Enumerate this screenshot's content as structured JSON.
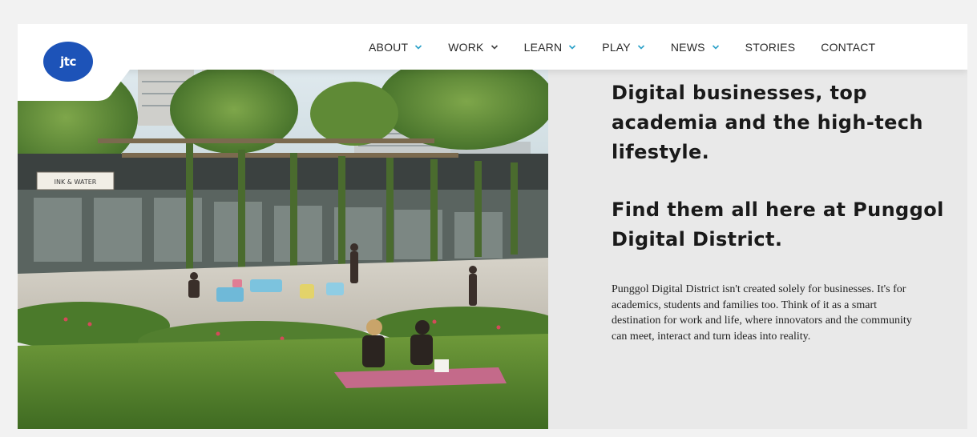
{
  "logo": {
    "text": "jtc"
  },
  "nav": {
    "items": [
      {
        "label": "ABOUT",
        "has_dropdown": true,
        "chevron_color": "#2aa0c8"
      },
      {
        "label": "WORK",
        "has_dropdown": true,
        "chevron_color": "#444444"
      },
      {
        "label": "LEARN",
        "has_dropdown": true,
        "chevron_color": "#2aa0c8"
      },
      {
        "label": "PLAY",
        "has_dropdown": true,
        "chevron_color": "#2aa0c8"
      },
      {
        "label": "NEWS",
        "has_dropdown": true,
        "chevron_color": "#2aa0c8"
      },
      {
        "label": "STORIES",
        "has_dropdown": false
      },
      {
        "label": "CONTACT",
        "has_dropdown": false
      }
    ]
  },
  "hero": {
    "image_sign_text": "INK & WATER",
    "headline_1": "Digital businesses, top academia and the high-tech lifestyle.",
    "headline_2": "Find them all here at Punggol Digital District.",
    "body": "Punggol Digital District isn't created solely for businesses. It's for academics, students and families too. Think of it as a smart destination for work and life, where innovators and the community can meet, interact and turn ideas into reality."
  },
  "colors": {
    "brand_blue": "#1d53b8",
    "accent_teal": "#2aa0c8",
    "panel_bg": "#e9e9e9"
  }
}
